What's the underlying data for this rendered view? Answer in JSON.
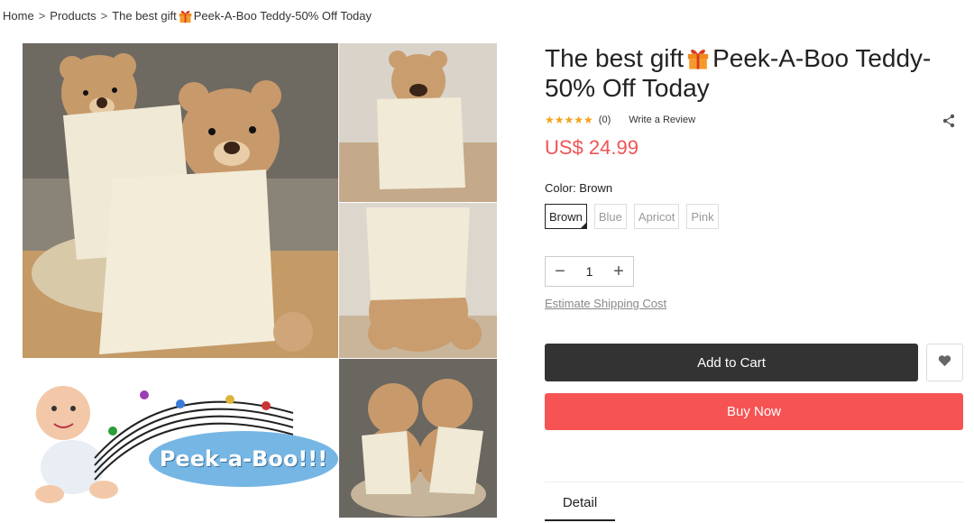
{
  "breadcrumb": {
    "home": "Home",
    "separator": ">",
    "products": "Products",
    "current_prefix": "The best gift",
    "current_suffix": "Peek-A-Boo Teddy-50% Off Today"
  },
  "gallery": {
    "peek_label": "Peek-a-Boo!!!"
  },
  "product": {
    "title_prefix": "The best gift",
    "title_suffix": "Peek-A-Boo Teddy-50% Off Today",
    "stars": "★★★★★",
    "review_count": "(0)",
    "write_review": "Write a Review",
    "price": "US$ 24.99",
    "color_label": "Color: Brown",
    "colors": [
      "Brown",
      "Blue",
      "Apricot",
      "Pink"
    ],
    "selected_color": "Brown",
    "quantity": "1",
    "qty_minus": "−",
    "qty_plus": "+",
    "shipping_link": "Estimate Shipping Cost",
    "add_to_cart": "Add to Cart",
    "buy_now": "Buy Now",
    "tab_detail": "Detail"
  },
  "colors": {
    "price": "#f05454",
    "buy_now_bg": "#f65353",
    "add_cart_bg": "#333333",
    "star": "#f2a41c"
  },
  "icons": {
    "gift": "gift-icon",
    "share": "share-icon",
    "wishlist": "heart-icon"
  }
}
